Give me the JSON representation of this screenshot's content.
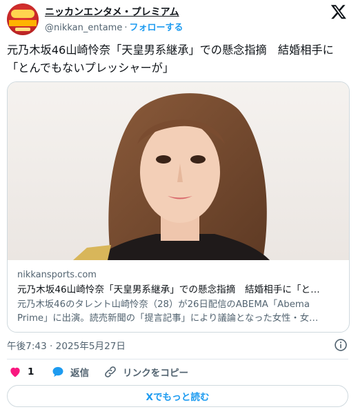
{
  "account": {
    "name": "ニッカンエンタメ・プレミアム",
    "handle": "@nikkan_entame",
    "separator": "·",
    "follow_label": "フォローする",
    "avatar_text": "PREMIUM"
  },
  "tweet": {
    "text": "元乃木坂46山崎怜奈「天皇男系継承」での懸念指摘　結婚相手に「とんでもないプレッシャーが」"
  },
  "card": {
    "domain": "nikkansports.com",
    "title": "元乃木坂46山崎怜奈「天皇男系継承」での懸念指摘　結婚相手に「と…",
    "description": "元乃木坂46のタレント山崎怜奈（28）が26日配信のABEMA「Abema Prime」に出演。読売新聞の「提言記事」により議論となった女性・女…"
  },
  "timestamp": "午後7:43 · 2025年5月27日",
  "actions": {
    "like_count": "1",
    "reply_label": "返信",
    "copy_link_label": "リンクをコピー"
  },
  "read_more_label": "Xでもっと読む",
  "colors": {
    "accent": "#1d9bf0",
    "like": "#f91880",
    "text": "#0f1419",
    "muted": "#536471",
    "border": "#cfd9de"
  },
  "icons": {
    "brand": "x-logo-icon",
    "info": "info-icon",
    "like": "heart-icon",
    "reply": "speech-bubble-icon",
    "copy_link": "link-icon"
  }
}
